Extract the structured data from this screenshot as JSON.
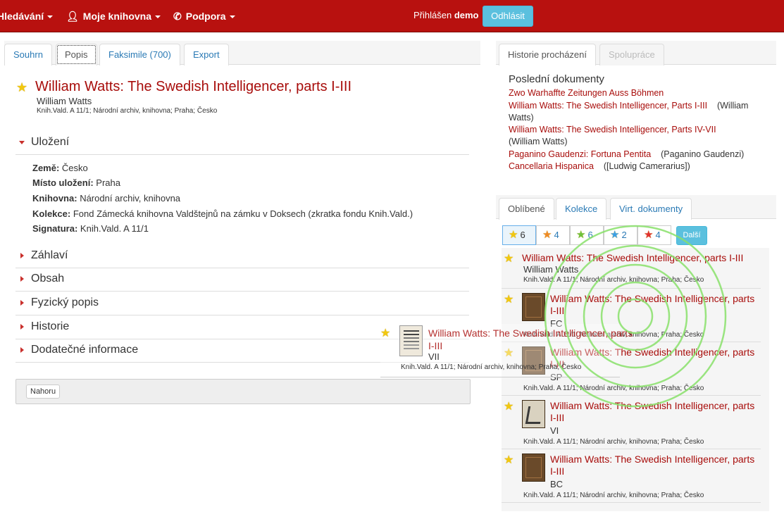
{
  "topnav": {
    "search_label": "Hledávání",
    "library_label": "Moje knihovna",
    "support_label": "Podpora",
    "logged_in_prefix": "Přihlášen",
    "username": "demo",
    "logout_label": "Odhlásit"
  },
  "left_tabs": [
    "Souhrn",
    "Popis",
    "Faksimile (700)",
    "Export"
  ],
  "record": {
    "title": "William Watts: The Swedish Intelligencer, parts I-III",
    "author": "William Watts",
    "meta": "Knih.Vald. A 11/1; Národní archiv, knihovna; Praha; Česko"
  },
  "sections": {
    "ulozeni": "Uložení",
    "zahlavi": "Záhlaví",
    "obsah": "Obsah",
    "fyzicky": "Fyzický popis",
    "historie": "Historie",
    "dodatecne": "Dodatečné informace"
  },
  "details": [
    {
      "label": "Země:",
      "value": "Česko"
    },
    {
      "label": "Místo uložení:",
      "value": "Praha"
    },
    {
      "label": "Knihovna:",
      "value": "Národní archiv, knihovna"
    },
    {
      "label": "Kolekce:",
      "value": "Fond Zámecká knihovna Valdštejnů na zámku v Doksech (zkratka fondu Knih.Vald.)"
    },
    {
      "label": "Signatura:",
      "value": "Knih.Vald. A 11/1"
    }
  ],
  "footer": {
    "top_button": "Nahoru"
  },
  "right_tabs": [
    "Historie procházení",
    "Spolupráce"
  ],
  "recent": {
    "title": "Poslední dokumenty",
    "items": [
      {
        "link": "Zwo Warhaffte Zeitungen Auss Böhmen",
        "author": ""
      },
      {
        "link": "William Watts: The Swedish Intelligencer, Parts I-III",
        "author": "(William Watts)"
      },
      {
        "link": "William Watts: The Swedish Intelligencer, Parts IV-VII",
        "author": "(William Watts)"
      },
      {
        "link": "Paganino Gaudenzi: Fortuna Pentita",
        "author": "(Paganino Gaudenzi)"
      },
      {
        "link": "Cancellaria Hispanica",
        "author": "([Ludwig Camerarius])"
      }
    ]
  },
  "fav_tabs": [
    "Oblíbené",
    "Kolekce",
    "Virt. dokumenty"
  ],
  "star_counts": [
    {
      "color": "#f2c80f",
      "count": "6"
    },
    {
      "color": "#f08a24",
      "count": "4"
    },
    {
      "color": "#6cc23a",
      "count": "6"
    },
    {
      "color": "#3aa0e8",
      "count": "2"
    },
    {
      "color": "#e23030",
      "count": "4"
    }
  ],
  "more_label": "Další",
  "favorites": [
    {
      "title": "William Watts: The Swedish Intelligencer, parts I-III",
      "sub": "William Watts",
      "meta": "Knih.Vald. A 11/1; Národní archiv, knihovna; Praha; Česko"
    },
    {
      "title": "William Watts: The Swedish Intelligencer, parts I-III",
      "sub": "FC",
      "meta": "Knih.Vald. A 11/1; Národní archiv, knihovna; Praha; Česko"
    },
    {
      "title": "William Watts: The Swedish Intelligencer, parts I-III",
      "sub": "SP",
      "meta": "Knih.Vald. A 11/1; Národní archiv, knihovna; Praha; Česko"
    },
    {
      "title": "William Watts: The Swedish Intelligencer, parts I-III",
      "sub": "VI",
      "meta": "Knih.Vald. A 11/1; Národní archiv, knihovna; Praha; Česko"
    },
    {
      "title": "William Watts: The Swedish Intelligencer, parts I-III",
      "sub": "BC",
      "meta": "Knih.Vald. A 11/1; Národní archiv, knihovna; Praha; Česko"
    }
  ],
  "drag_ghost": {
    "title": "William Watts: The Swedish Intelligencer, parts I-III",
    "sub": "VII",
    "meta": "Knih.Vald. A 11/1; Národní archiv, knihovna; Praha; Česko"
  }
}
